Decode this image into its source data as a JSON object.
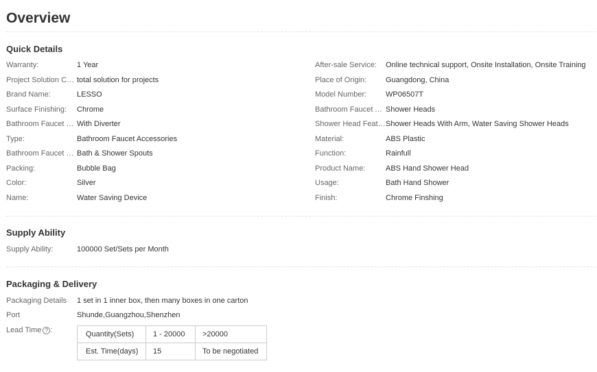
{
  "overview_title": "Overview",
  "quick_details": {
    "title": "Quick Details",
    "left": [
      {
        "label": "Warranty:",
        "value": "1 Year"
      },
      {
        "label": "Project Solution Ca...",
        "value": "total solution for projects"
      },
      {
        "label": "Brand Name:",
        "value": "LESSO"
      },
      {
        "label": "Surface Finishing:",
        "value": "Chrome"
      },
      {
        "label": "Bathroom Faucet S...",
        "value": "With Diverter"
      },
      {
        "label": "Type:",
        "value": "Bathroom Faucet Accessories"
      },
      {
        "label": "Bathroom Faucet S...",
        "value": "Bath & Shower Spouts"
      },
      {
        "label": "Packing:",
        "value": "Bubble Bag"
      },
      {
        "label": "Color:",
        "value": "Silver"
      },
      {
        "label": "Name:",
        "value": "Water Saving Device"
      }
    ],
    "right": [
      {
        "label": "After-sale Service:",
        "value": "Online technical support, Onsite Installation, Onsite Training"
      },
      {
        "label": "Place of Origin:",
        "value": "Guangdong, China"
      },
      {
        "label": "Model Number:",
        "value": "WP06507T"
      },
      {
        "label": "Bathroom Faucet A...",
        "value": "Shower Heads"
      },
      {
        "label": "Shower Head Featu...",
        "value": "Shower Heads With Arm, Water Saving Shower Heads"
      },
      {
        "label": "Material:",
        "value": "ABS Plastic"
      },
      {
        "label": "Function:",
        "value": "Rainfull"
      },
      {
        "label": "Product Name:",
        "value": "ABS Hand Shower Head"
      },
      {
        "label": "Usage:",
        "value": "Bath Hand Shower"
      },
      {
        "label": "Finish:",
        "value": "Chrome Finshing"
      }
    ]
  },
  "supply_ability": {
    "title": "Supply Ability",
    "label": "Supply Ability:",
    "value": "100000 Set/Sets per Month"
  },
  "packaging": {
    "title": "Packaging & Delivery",
    "details_label": "Packaging Details",
    "details_value": "1 set in 1 inner box, then many boxes in one carton",
    "port_label": "Port",
    "port_value": "Shunde,Guangzhou,Shenzhen",
    "lead_time_label": "Lead Time",
    "lead_time_suffix": ":",
    "help_icon": "question-circle-icon",
    "help_glyph": "?",
    "lead_table": {
      "header": [
        "Quantity(Sets)",
        "1 - 20000",
        ">20000"
      ],
      "row": [
        "Est. Time(days)",
        "15",
        "To be negotiated"
      ]
    }
  }
}
